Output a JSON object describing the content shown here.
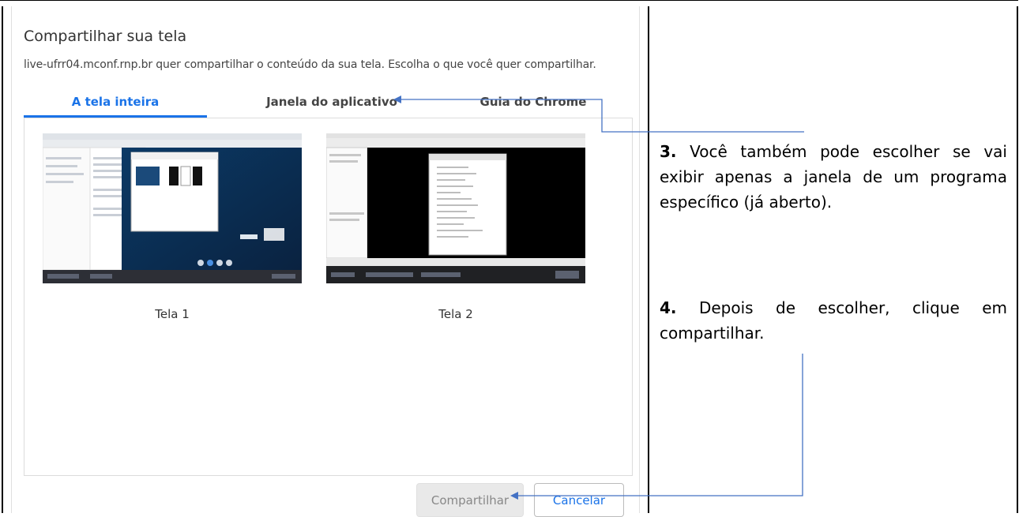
{
  "dialog": {
    "title": "Compartilhar sua tela",
    "description": "live-ufrr04.mconf.rnp.br quer compartilhar o conteúdo da sua tela. Escolha o que você quer compartilhar.",
    "tabs": [
      {
        "label": "A tela inteira",
        "active": true
      },
      {
        "label": "Janela do aplicativo",
        "active": false
      },
      {
        "label": "Guia do Chrome",
        "active": false
      }
    ],
    "screens": [
      {
        "label": "Tela 1"
      },
      {
        "label": "Tela 2"
      }
    ],
    "buttons": {
      "share": "Compartilhar",
      "cancel": "Cancelar"
    }
  },
  "notes": [
    {
      "number": "3.",
      "text": "Você também pode escolher se vai exibir apenas a janela de um programa específico (já aberto)."
    },
    {
      "number": "4.",
      "text": "Depois de escolher, clique em compartilhar."
    }
  ],
  "colors": {
    "accent": "#1a73e8",
    "arrow": "#4472c4"
  }
}
